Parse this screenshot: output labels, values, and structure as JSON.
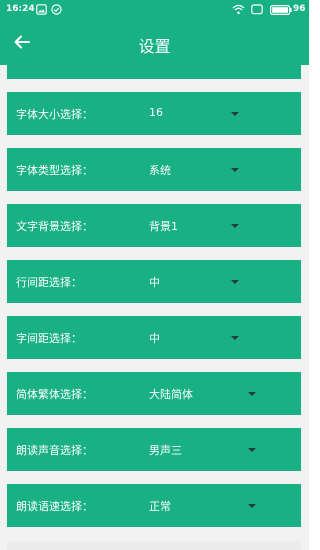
{
  "status_bar": {
    "time": "16:24",
    "battery": "96",
    "icons": [
      "photo-icon",
      "check-circle-icon",
      "wifi-icon",
      "screen-icon",
      "battery-icon"
    ]
  },
  "header": {
    "title": "设置",
    "back_icon": "arrow-left-icon"
  },
  "settings": [
    {
      "label": "字体大小选择：",
      "value": "16"
    },
    {
      "label": "字体类型选择：",
      "value": "系统"
    },
    {
      "label": "文字背景选择：",
      "value": "背景1"
    },
    {
      "label": "行间距选择：",
      "value": "中"
    },
    {
      "label": "字间距选择：",
      "value": "中"
    },
    {
      "label": "简体繁体选择：",
      "value": "大陆简体"
    },
    {
      "label": "朗读声音选择：",
      "value": "男声三"
    },
    {
      "label": "朗读语速选择：",
      "value": "正常"
    }
  ],
  "colors": {
    "accent": "#17b184",
    "row": "#19b183",
    "background": "#f2f2f2",
    "caret": "#1e3d33"
  }
}
